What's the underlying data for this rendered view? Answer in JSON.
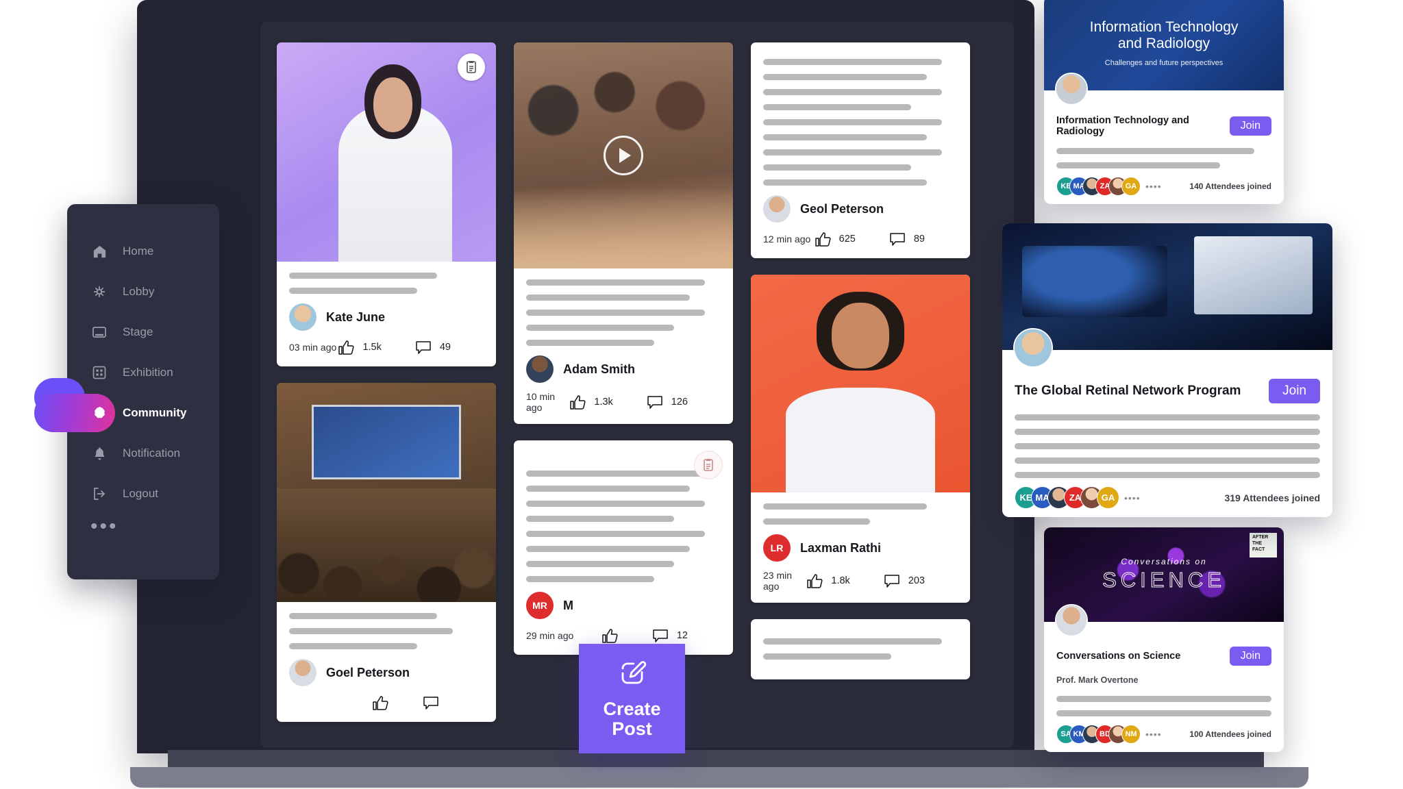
{
  "sidebar": {
    "items": [
      {
        "label": "Home",
        "icon": "home-icon",
        "active": false
      },
      {
        "label": "Lobby",
        "icon": "lobby-network-icon",
        "active": false
      },
      {
        "label": "Stage",
        "icon": "stage-screen-icon",
        "active": false
      },
      {
        "label": "Exhibition",
        "icon": "exhibition-grid-icon",
        "active": false
      },
      {
        "label": "Community",
        "icon": "community-brain-icon",
        "active": true
      },
      {
        "label": "Notification",
        "icon": "bell-icon",
        "active": false
      },
      {
        "label": "Logout",
        "icon": "logout-arrow-icon",
        "active": false
      }
    ],
    "more_label": "•••",
    "active_pill_gradient": [
      "#6c4ff6",
      "#a13bd6",
      "#e0339c"
    ],
    "background": "#2e2f40"
  },
  "create_post": {
    "label": "Create\nPost",
    "line1": "Create",
    "line2": "Post",
    "icon": "edit-pencil-icon",
    "color": "#7a5cf0"
  },
  "feed": {
    "background": "#2b2c3a",
    "columns": [
      {
        "posts": [
          {
            "media": "doctor-photo",
            "bookmark": true,
            "bookmark_style": "white",
            "lines_top": [
              "l76",
              "l66"
            ],
            "author": "Kate June",
            "avatar_type": "photo",
            "time": "03 min ago",
            "likes": "1.5k",
            "comments": "49"
          },
          {
            "media": "conference-photo",
            "bookmark": false,
            "lines_top": [
              "l76",
              "l84",
              "l66"
            ],
            "author": "Goel Peterson",
            "avatar_type": "photo",
            "time": "",
            "likes": "",
            "comments": ""
          }
        ]
      },
      {
        "posts": [
          {
            "media": "party-video",
            "video": true,
            "bookmark": false,
            "lines_top": [
              "l92",
              "l84",
              "l92",
              "l76",
              "l66"
            ],
            "author": "Adam Smith",
            "avatar_type": "photo",
            "time": "10 min ago",
            "likes": "1.3k",
            "comments": "126"
          },
          {
            "media": "none",
            "bookmark": true,
            "bookmark_style": "pale",
            "lines_top": [
              "l92",
              "l84",
              "l92",
              "l76",
              "l92",
              "l84",
              "l76",
              "l66"
            ],
            "author": "M",
            "avatar_type": "initials",
            "avatar_initials": "MR",
            "avatar_color": "#de2d2d",
            "time": "29 min ago",
            "likes": "",
            "comments": "12"
          }
        ]
      },
      {
        "posts": [
          {
            "media": "none",
            "bookmark": false,
            "lines_top": [
              "l92",
              "l84",
              "l92",
              "l76",
              "l92",
              "l84",
              "l92",
              "l76",
              "l84"
            ],
            "author": "Geol Peterson",
            "avatar_type": "photo",
            "time": "12 min ago",
            "likes": "625",
            "comments": "89"
          },
          {
            "media": "man-orange-photo",
            "bookmark": false,
            "lines_top": [
              "l84",
              "l55"
            ],
            "author": "Laxman Rathi",
            "avatar_type": "initials",
            "avatar_initials": "LR",
            "avatar_color": "#de2d2d",
            "time": "23 min ago",
            "likes": "1.8k",
            "comments": "203"
          },
          {
            "media": "none",
            "bookmark": false,
            "lines_top": [
              "l92",
              "l66"
            ],
            "author": "",
            "avatar_type": "none",
            "time": "",
            "likes": "",
            "comments": ""
          }
        ]
      }
    ]
  },
  "events": [
    {
      "banner_kind": "it-radiology",
      "banner_title": "Information Technology\nand Radiology",
      "banner_title_l1": "Information Technology",
      "banner_title_l2": "and Radiology",
      "banner_subtitle": "Challenges and future perspectives",
      "title": "Information Technology and Radiology",
      "join_label": "Join",
      "speaker": "",
      "lines": [
        "l92",
        "l76"
      ],
      "attendees_label": "140 Attendees joined",
      "stackers": [
        {
          "initials": "KE",
          "color": "#1d9e93"
        },
        {
          "initials": "MA",
          "color": "#2a5bbf"
        },
        {
          "initials": "",
          "color": "#2e3b52"
        },
        {
          "initials": "ZA",
          "color": "#e02a2a"
        },
        {
          "initials": "",
          "color": "#3a4250"
        },
        {
          "initials": "GA",
          "color": "#e0a812"
        }
      ],
      "stacker_more": "••••"
    },
    {
      "banner_kind": "retinal",
      "banner_title": "",
      "banner_title_l1": "",
      "banner_title_l2": "",
      "banner_subtitle": "",
      "title": "The Global Retinal Network Program",
      "join_label": "Join",
      "speaker": "",
      "lines": [
        "l100",
        "l100",
        "l100",
        "l100",
        "l100"
      ],
      "attendees_label": "319 Attendees joined",
      "stackers": [
        {
          "initials": "KE",
          "color": "#1d9e93"
        },
        {
          "initials": "MA",
          "color": "#2a5bbf"
        },
        {
          "initials": "",
          "color": "#2e3b52"
        },
        {
          "initials": "ZA",
          "color": "#e02a2a"
        },
        {
          "initials": "",
          "color": "#3a4250"
        },
        {
          "initials": "GA",
          "color": "#e0a812"
        }
      ],
      "stacker_more": "••••"
    },
    {
      "banner_kind": "science",
      "banner_title": "",
      "banner_title_l1": "Conversations on",
      "banner_title_l2": "SCIENCE",
      "banner_subtitle": "",
      "banner_badge": "AFTER\nTHE\nFACT",
      "title": "Conversations on Science",
      "join_label": "Join",
      "speaker": "Prof. Mark Overtone",
      "lines": [
        "l100",
        "l100"
      ],
      "attendees_label": "100 Attendees joined",
      "stackers": [
        {
          "initials": "SA",
          "color": "#1d9e93"
        },
        {
          "initials": "KM",
          "color": "#2a5bbf"
        },
        {
          "initials": "",
          "color": "#2e3b52"
        },
        {
          "initials": "BD",
          "color": "#e02a2a"
        },
        {
          "initials": "",
          "color": "#3a4250"
        },
        {
          "initials": "NM",
          "color": "#e0a812"
        }
      ],
      "stacker_more": "••••"
    }
  ],
  "colors": {
    "accent": "#7a5cf0",
    "screen_bg": "#232432",
    "feed_bg": "#2b2c3a",
    "sidebar_bg": "#2e2f40",
    "skeleton": "#b9b9b9",
    "laptop_lip": "#414252",
    "laptop_base": "#7c7e8e"
  }
}
